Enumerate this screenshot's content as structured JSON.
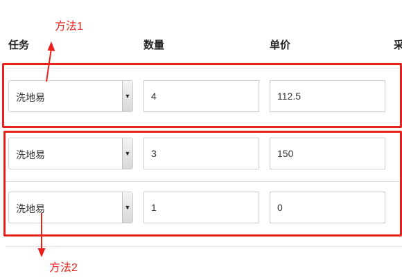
{
  "headers": {
    "task": "任务",
    "quantity": "数量",
    "unit_price": "单价",
    "cut": "采"
  },
  "annotations": {
    "method1": "方法1",
    "method2": "方法2"
  },
  "rows": [
    {
      "task": "洗地易",
      "quantity": "4",
      "unit_price": "112.5"
    },
    {
      "task": "洗地易",
      "quantity": "3",
      "unit_price": "150"
    },
    {
      "task": "洗地易",
      "quantity": "1",
      "unit_price": "0"
    }
  ],
  "colors": {
    "annotation_red": "#e8221b",
    "border_gray": "#cfcfcf"
  },
  "icons": {
    "select_arrow": "triangle-down-icon"
  }
}
